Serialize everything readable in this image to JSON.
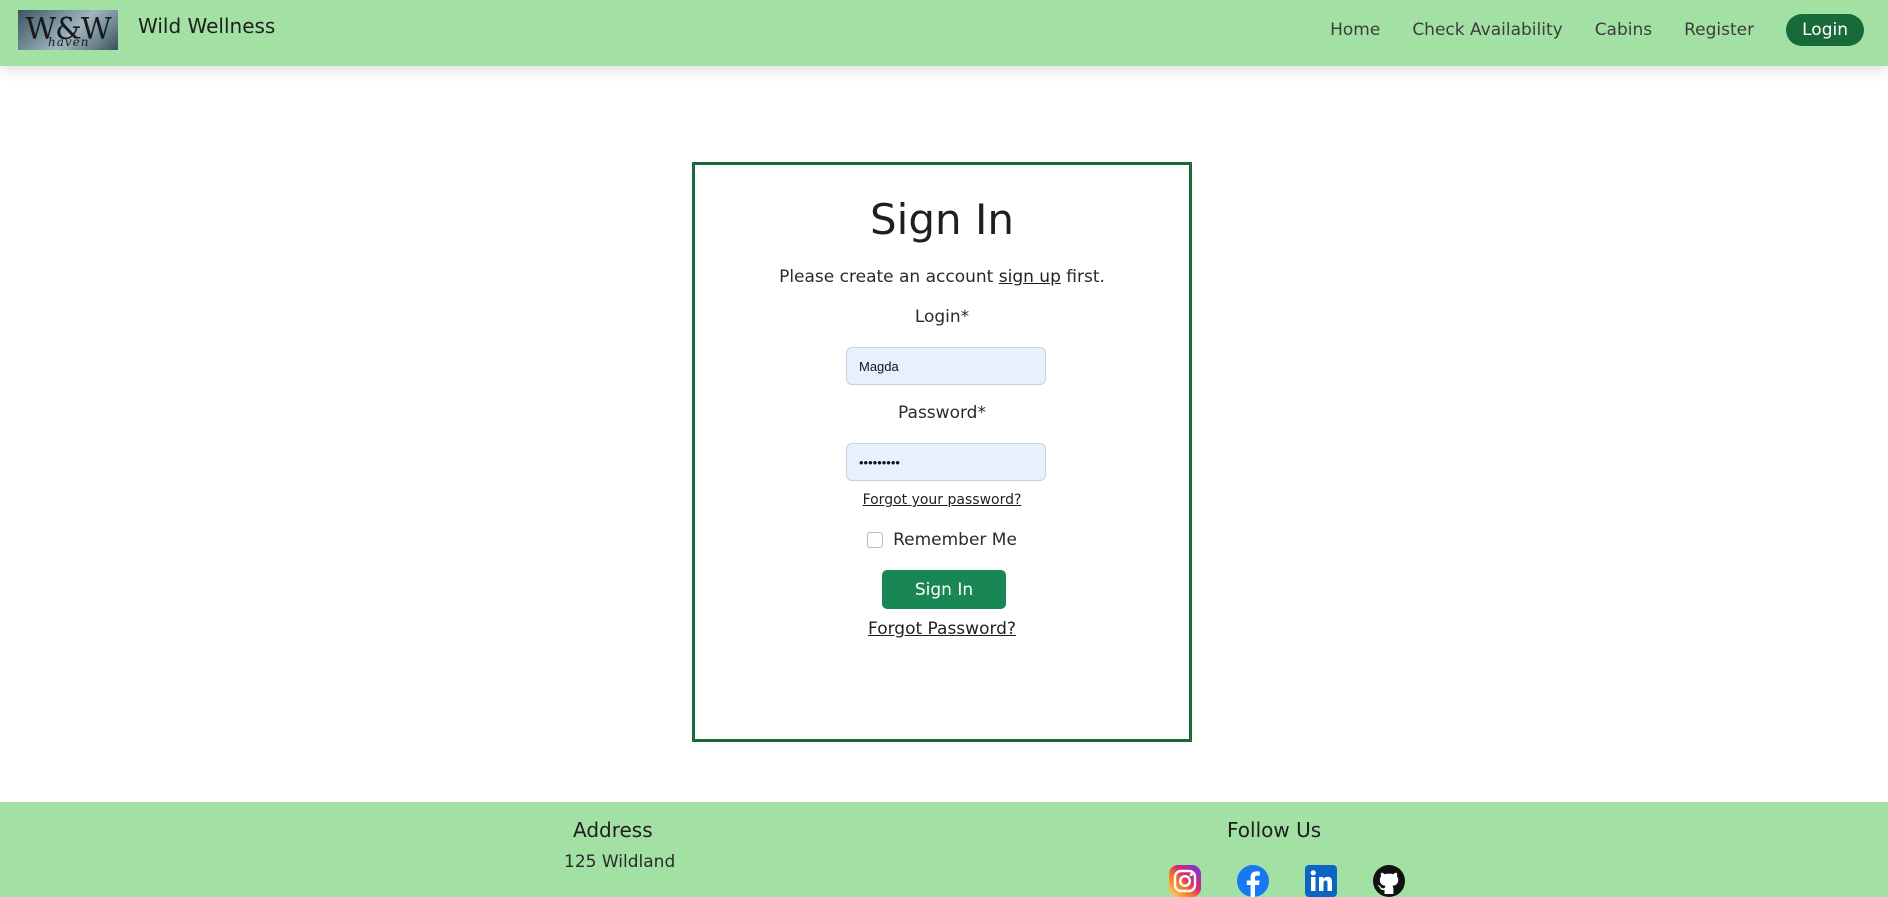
{
  "navbar": {
    "logo_text": "W&W",
    "logo_sub": "haven",
    "brand": "Wild Wellness",
    "links": [
      {
        "label": "Home"
      },
      {
        "label": "Check Availability"
      },
      {
        "label": "Cabins"
      },
      {
        "label": "Register"
      }
    ],
    "login_label": "Login"
  },
  "signin": {
    "title": "Sign In",
    "intro_before": "Please create an account ",
    "intro_link": "sign up",
    "intro_after": " first.",
    "login_label": "Login*",
    "login_value": "Magda",
    "password_label": "Password*",
    "password_value": "•••••••••",
    "forgot_small": "Forgot your password?",
    "remember_label": "Remember Me",
    "button_label": "Sign In",
    "forgot_large": "Forgot Password?"
  },
  "footer": {
    "address_heading": "Address",
    "address_line1": "125 Wildland",
    "address_line2": "",
    "follow_heading": "Follow Us",
    "socials": [
      "instagram-icon",
      "facebook-icon",
      "linkedin-icon",
      "github-icon"
    ]
  },
  "colors": {
    "nav_bg": "#a3e0a3",
    "accent": "#186a3b",
    "button": "#198754"
  }
}
